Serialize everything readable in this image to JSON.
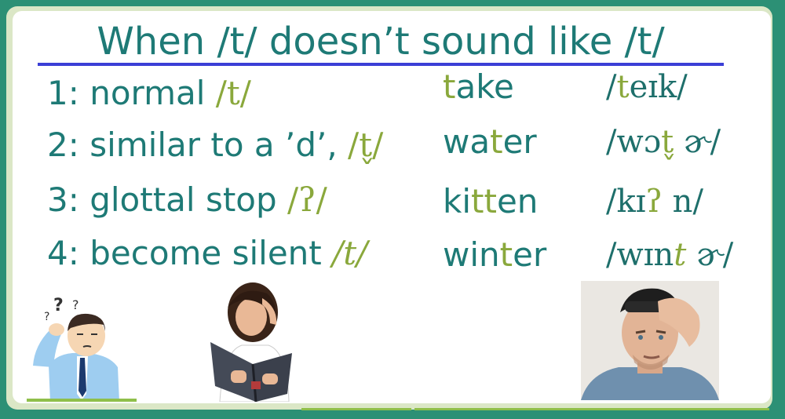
{
  "title": "When /t/ doesn’t sound like /t/",
  "rows": [
    {
      "label": "1: normal ",
      "ipa": "/t/",
      "word": [
        "",
        "t",
        "ake"
      ],
      "phon": [
        "/",
        "t",
        "eɪk/"
      ]
    },
    {
      "label": "2: similar to a ’d’, ",
      "ipa": "/t̬/",
      "word": [
        "wa",
        "t",
        "er"
      ],
      "phon": [
        "/wɔ",
        "t̬",
        " ɚ/"
      ]
    },
    {
      "label": "3: glottal stop ",
      "ipa": "/ʔ/",
      "word": [
        "ki",
        "tt",
        "en"
      ],
      "phon": [
        "/kɪ",
        "ʔ",
        " n/"
      ]
    },
    {
      "label": "4: become silent ",
      "ipa": "/t/",
      "word": [
        "win",
        "t",
        "er"
      ],
      "phon": [
        "/wɪn",
        "t",
        " ɚ/"
      ]
    }
  ],
  "pictures": {
    "confused": {
      "marks": "?",
      "marks2": "?",
      "marks3": "?"
    }
  },
  "colors": {
    "frame": "#2c9075",
    "text": "#1e7a76",
    "accent": "#8aa83c",
    "title_rule": "#3b3fd6"
  }
}
